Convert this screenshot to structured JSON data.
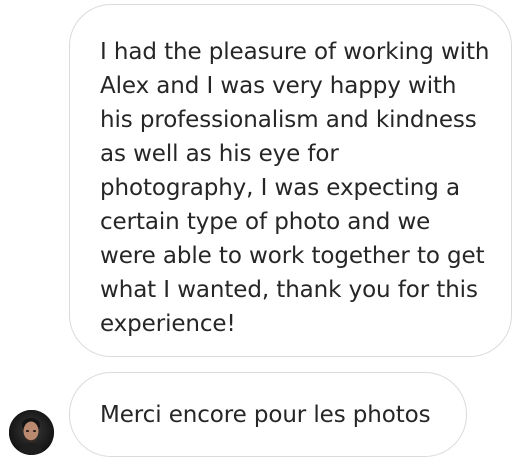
{
  "messages": [
    {
      "text": "I had the pleasure of working with Alex and I was very happy with his professionalism and kindness as well as his eye for photography, I was expecting a certain type of photo and we were able to work together to get what I wanted, thank you for this experience!"
    },
    {
      "text": "Merci encore pour les photos"
    }
  ],
  "avatar": {
    "icon": "profile-photo-icon"
  },
  "colors": {
    "bubble_border": "#dbdbdb",
    "text": "#262626",
    "background": "#ffffff"
  }
}
